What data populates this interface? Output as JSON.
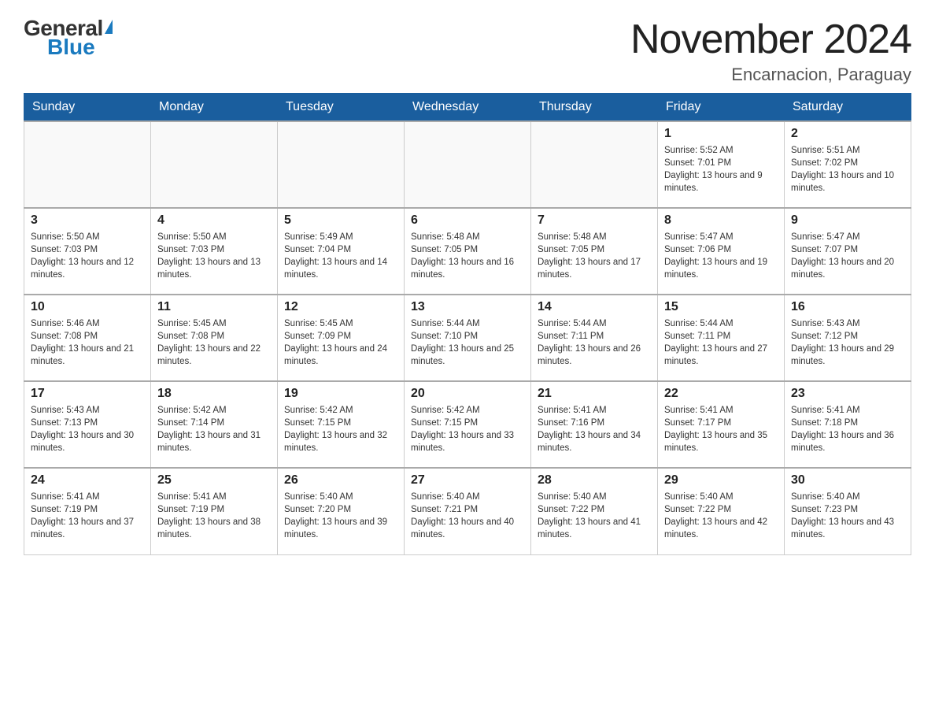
{
  "header": {
    "logo": {
      "general": "General",
      "blue": "Blue"
    },
    "title": "November 2024",
    "location": "Encarnacion, Paraguay"
  },
  "calendar": {
    "days_of_week": [
      "Sunday",
      "Monday",
      "Tuesday",
      "Wednesday",
      "Thursday",
      "Friday",
      "Saturday"
    ],
    "weeks": [
      [
        {
          "day": "",
          "info": ""
        },
        {
          "day": "",
          "info": ""
        },
        {
          "day": "",
          "info": ""
        },
        {
          "day": "",
          "info": ""
        },
        {
          "day": "",
          "info": ""
        },
        {
          "day": "1",
          "info": "Sunrise: 5:52 AM\nSunset: 7:01 PM\nDaylight: 13 hours and 9 minutes."
        },
        {
          "day": "2",
          "info": "Sunrise: 5:51 AM\nSunset: 7:02 PM\nDaylight: 13 hours and 10 minutes."
        }
      ],
      [
        {
          "day": "3",
          "info": "Sunrise: 5:50 AM\nSunset: 7:03 PM\nDaylight: 13 hours and 12 minutes."
        },
        {
          "day": "4",
          "info": "Sunrise: 5:50 AM\nSunset: 7:03 PM\nDaylight: 13 hours and 13 minutes."
        },
        {
          "day": "5",
          "info": "Sunrise: 5:49 AM\nSunset: 7:04 PM\nDaylight: 13 hours and 14 minutes."
        },
        {
          "day": "6",
          "info": "Sunrise: 5:48 AM\nSunset: 7:05 PM\nDaylight: 13 hours and 16 minutes."
        },
        {
          "day": "7",
          "info": "Sunrise: 5:48 AM\nSunset: 7:05 PM\nDaylight: 13 hours and 17 minutes."
        },
        {
          "day": "8",
          "info": "Sunrise: 5:47 AM\nSunset: 7:06 PM\nDaylight: 13 hours and 19 minutes."
        },
        {
          "day": "9",
          "info": "Sunrise: 5:47 AM\nSunset: 7:07 PM\nDaylight: 13 hours and 20 minutes."
        }
      ],
      [
        {
          "day": "10",
          "info": "Sunrise: 5:46 AM\nSunset: 7:08 PM\nDaylight: 13 hours and 21 minutes."
        },
        {
          "day": "11",
          "info": "Sunrise: 5:45 AM\nSunset: 7:08 PM\nDaylight: 13 hours and 22 minutes."
        },
        {
          "day": "12",
          "info": "Sunrise: 5:45 AM\nSunset: 7:09 PM\nDaylight: 13 hours and 24 minutes."
        },
        {
          "day": "13",
          "info": "Sunrise: 5:44 AM\nSunset: 7:10 PM\nDaylight: 13 hours and 25 minutes."
        },
        {
          "day": "14",
          "info": "Sunrise: 5:44 AM\nSunset: 7:11 PM\nDaylight: 13 hours and 26 minutes."
        },
        {
          "day": "15",
          "info": "Sunrise: 5:44 AM\nSunset: 7:11 PM\nDaylight: 13 hours and 27 minutes."
        },
        {
          "day": "16",
          "info": "Sunrise: 5:43 AM\nSunset: 7:12 PM\nDaylight: 13 hours and 29 minutes."
        }
      ],
      [
        {
          "day": "17",
          "info": "Sunrise: 5:43 AM\nSunset: 7:13 PM\nDaylight: 13 hours and 30 minutes."
        },
        {
          "day": "18",
          "info": "Sunrise: 5:42 AM\nSunset: 7:14 PM\nDaylight: 13 hours and 31 minutes."
        },
        {
          "day": "19",
          "info": "Sunrise: 5:42 AM\nSunset: 7:15 PM\nDaylight: 13 hours and 32 minutes."
        },
        {
          "day": "20",
          "info": "Sunrise: 5:42 AM\nSunset: 7:15 PM\nDaylight: 13 hours and 33 minutes."
        },
        {
          "day": "21",
          "info": "Sunrise: 5:41 AM\nSunset: 7:16 PM\nDaylight: 13 hours and 34 minutes."
        },
        {
          "day": "22",
          "info": "Sunrise: 5:41 AM\nSunset: 7:17 PM\nDaylight: 13 hours and 35 minutes."
        },
        {
          "day": "23",
          "info": "Sunrise: 5:41 AM\nSunset: 7:18 PM\nDaylight: 13 hours and 36 minutes."
        }
      ],
      [
        {
          "day": "24",
          "info": "Sunrise: 5:41 AM\nSunset: 7:19 PM\nDaylight: 13 hours and 37 minutes."
        },
        {
          "day": "25",
          "info": "Sunrise: 5:41 AM\nSunset: 7:19 PM\nDaylight: 13 hours and 38 minutes."
        },
        {
          "day": "26",
          "info": "Sunrise: 5:40 AM\nSunset: 7:20 PM\nDaylight: 13 hours and 39 minutes."
        },
        {
          "day": "27",
          "info": "Sunrise: 5:40 AM\nSunset: 7:21 PM\nDaylight: 13 hours and 40 minutes."
        },
        {
          "day": "28",
          "info": "Sunrise: 5:40 AM\nSunset: 7:22 PM\nDaylight: 13 hours and 41 minutes."
        },
        {
          "day": "29",
          "info": "Sunrise: 5:40 AM\nSunset: 7:22 PM\nDaylight: 13 hours and 42 minutes."
        },
        {
          "day": "30",
          "info": "Sunrise: 5:40 AM\nSunset: 7:23 PM\nDaylight: 13 hours and 43 minutes."
        }
      ]
    ]
  }
}
